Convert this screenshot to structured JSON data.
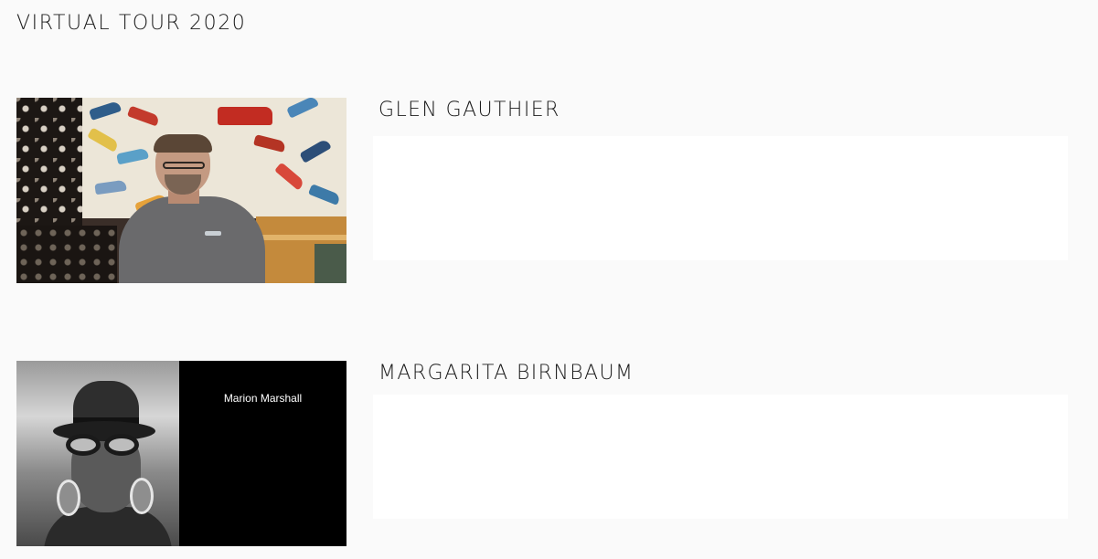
{
  "page": {
    "title": "VIRTUAL TOUR 2020"
  },
  "artists": [
    {
      "name": "GLEN GAUTHIER",
      "thumbnail_icon": "video-thumbnail"
    },
    {
      "name": "MARGARITA BIRNBAUM",
      "thumbnail_icon": "video-thumbnail",
      "thumbnail_caption": "Marion Marshall"
    }
  ]
}
